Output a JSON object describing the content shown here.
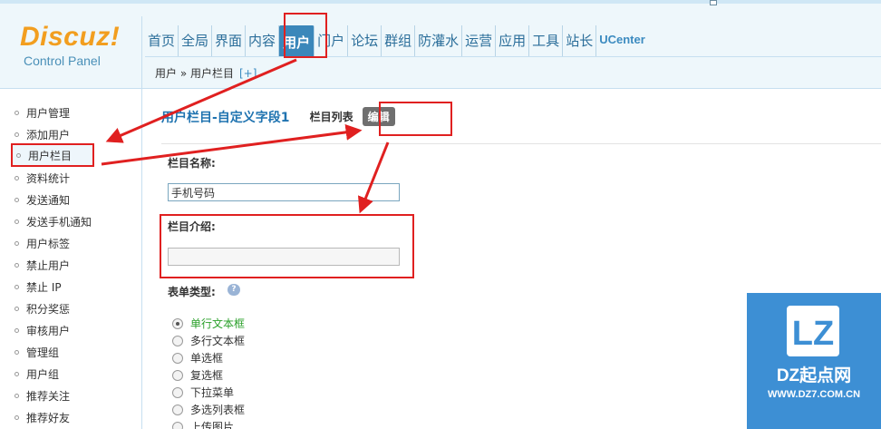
{
  "logo": {
    "brand": "Discuz!",
    "subtitle": "Control Panel"
  },
  "nav": {
    "items": [
      "首页",
      "全局",
      "界面",
      "内容",
      "用户",
      "门户",
      "论坛",
      "群组",
      "防灌水",
      "运营",
      "应用",
      "工具",
      "站长",
      "UCenter"
    ],
    "active": "用户"
  },
  "breadcrumb": {
    "path": "用户 » 用户栏目",
    "add": "[+]"
  },
  "sidebar": {
    "items": [
      {
        "label": "用户管理"
      },
      {
        "label": "添加用户"
      },
      {
        "label": "用户栏目"
      },
      {
        "label": "资料统计"
      },
      {
        "label": "发送通知"
      },
      {
        "label": "发送手机通知"
      },
      {
        "label": "用户标签"
      },
      {
        "label": "禁止用户"
      },
      {
        "label": "禁止 IP"
      },
      {
        "label": "积分奖惩"
      },
      {
        "label": "审核用户"
      },
      {
        "label": "管理组"
      },
      {
        "label": "用户组"
      },
      {
        "label": "推荐关注"
      },
      {
        "label": "推荐好友"
      }
    ],
    "active_index": 2
  },
  "main": {
    "title": "用户栏目-自定义字段1",
    "tabs": {
      "list": "栏目列表",
      "edit": "编辑"
    },
    "field_name": {
      "label": "栏目名称:",
      "value": "手机号码"
    },
    "field_intro": {
      "label": "栏目介绍:",
      "value": ""
    },
    "form_type": {
      "label": "表单类型:",
      "help_icon": "question-bubble-icon",
      "options": [
        "单行文本框",
        "多行文本框",
        "单选框",
        "复选框",
        "下拉菜单",
        "多选列表框",
        "上传图片"
      ],
      "selected": 0
    }
  },
  "watermark": {
    "logo_text": "LZ",
    "name": "DZ起点网",
    "url": "WWW.DZ7.COM.CN"
  },
  "colors": {
    "accent": "#3b87ba",
    "annotation": "#e02020",
    "selected_option": "#2aa02a",
    "watermark": "#3d8fd4"
  }
}
